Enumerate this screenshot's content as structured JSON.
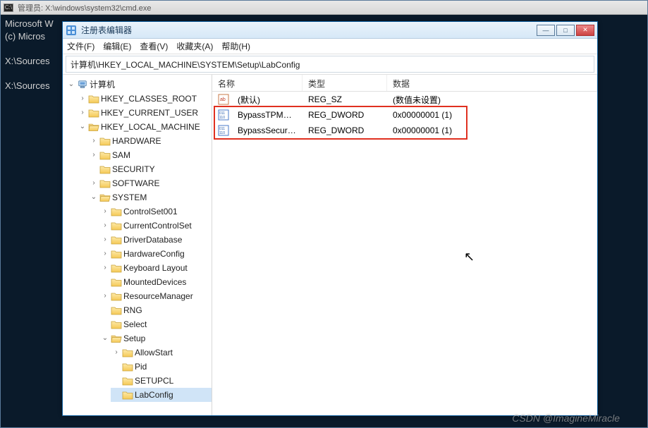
{
  "cmd": {
    "title": "管理员: X:\\windows\\system32\\cmd.exe",
    "line1": "Microsoft W",
    "line2": "(c) Micros",
    "line3": "X:\\Sources",
    "line4": "X:\\Sources"
  },
  "regedit": {
    "title": "注册表编辑器",
    "menu": {
      "file": "文件(F)",
      "edit": "编辑(E)",
      "view": "查看(V)",
      "favorites": "收藏夹(A)",
      "help": "帮助(H)"
    },
    "address": "计算机\\HKEY_LOCAL_MACHINE\\SYSTEM\\Setup\\LabConfig",
    "columns": {
      "name": "名称",
      "type": "类型",
      "data": "数据"
    },
    "values": [
      {
        "name": "(默认)",
        "type": "REG_SZ",
        "data": "(数值未设置)",
        "kind": "sz"
      },
      {
        "name": "BypassTPMCh...",
        "type": "REG_DWORD",
        "data": "0x00000001 (1)",
        "kind": "dword"
      },
      {
        "name": "BypassSecure...",
        "type": "REG_DWORD",
        "data": "0x00000001 (1)",
        "kind": "dword"
      }
    ],
    "tree": {
      "root": "计算机",
      "hkcr": "HKEY_CLASSES_ROOT",
      "hkcu": "HKEY_CURRENT_USER",
      "hklm": "HKEY_LOCAL_MACHINE",
      "hardware": "HARDWARE",
      "sam": "SAM",
      "security": "SECURITY",
      "software": "SOFTWARE",
      "system": "SYSTEM",
      "controlset001": "ControlSet001",
      "currentcontrolset": "CurrentControlSet",
      "driverdatabase": "DriverDatabase",
      "hardwareconfig": "HardwareConfig",
      "keyboardlayout": "Keyboard Layout",
      "mounteddevices": "MountedDevices",
      "resourcemanager": "ResourceManager",
      "rng": "RNG",
      "select": "Select",
      "setup": "Setup",
      "allowstart": "AllowStart",
      "pid": "Pid",
      "setupcl": "SETUPCL",
      "labconfig": "LabConfig"
    }
  },
  "watermark": "CSDN @ImagineMiracle"
}
